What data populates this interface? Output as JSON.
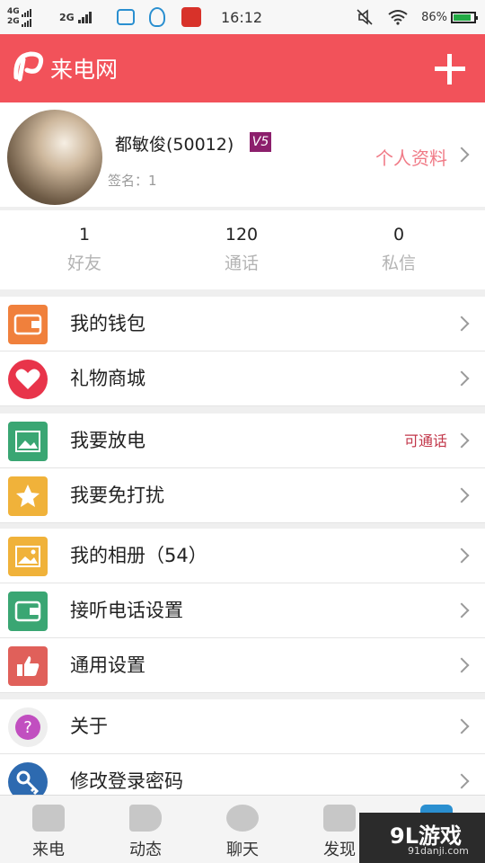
{
  "status_bar": {
    "net1": "4G",
    "net2": "2G",
    "net3": "2G",
    "time": "16:12",
    "battery": "86%"
  },
  "header": {
    "title": "来电网",
    "add_icon": "plus-icon"
  },
  "profile": {
    "name": "都敏俊(50012)",
    "vip_badge": "V5",
    "signature": "签名：1",
    "profile_link": "个人资料"
  },
  "stats": [
    {
      "value": "1",
      "label": "好友"
    },
    {
      "value": "120",
      "label": "通话"
    },
    {
      "value": "0",
      "label": "私信"
    }
  ],
  "menu": [
    {
      "label": "我的钱包",
      "icon": "wallet-icon",
      "color": "#f0803c",
      "note": ""
    },
    {
      "label": "礼物商城",
      "icon": "heart-icon",
      "color": "#e8344a",
      "note": ""
    },
    {
      "label": "我要放电",
      "icon": "image-icon",
      "color": "#3aa673",
      "note": "可通话"
    },
    {
      "label": "我要免打扰",
      "icon": "star-icon",
      "color": "#f0b23a",
      "note": ""
    },
    {
      "label": "我的相册（54）",
      "icon": "album-icon",
      "color": "#f0b23a",
      "note": ""
    },
    {
      "label": "接听电话设置",
      "icon": "phone-settings-icon",
      "color": "#3aa673",
      "note": ""
    },
    {
      "label": "通用设置",
      "icon": "thumbs-up-icon",
      "color": "#e0605a",
      "note": ""
    },
    {
      "label": "关于",
      "icon": "question-icon",
      "color": "#c14fc0",
      "note": ""
    },
    {
      "label": "修改登录密码",
      "icon": "key-icon",
      "color": "#2d6ab0",
      "note": ""
    }
  ],
  "bottom_nav": [
    {
      "label": "来电",
      "icon": "chat-bubble-icon"
    },
    {
      "label": "动态",
      "icon": "megaphone-icon"
    },
    {
      "label": "聊天",
      "icon": "speech-icon"
    },
    {
      "label": "发现",
      "icon": "discover-icon"
    },
    {
      "label": "",
      "icon": "me-icon"
    }
  ],
  "watermark": {
    "main": "9L游戏",
    "sub": "91danji.com"
  },
  "colors": {
    "header": "#f2525a",
    "accent_link": "#f07a86",
    "note": "#c2374a"
  }
}
